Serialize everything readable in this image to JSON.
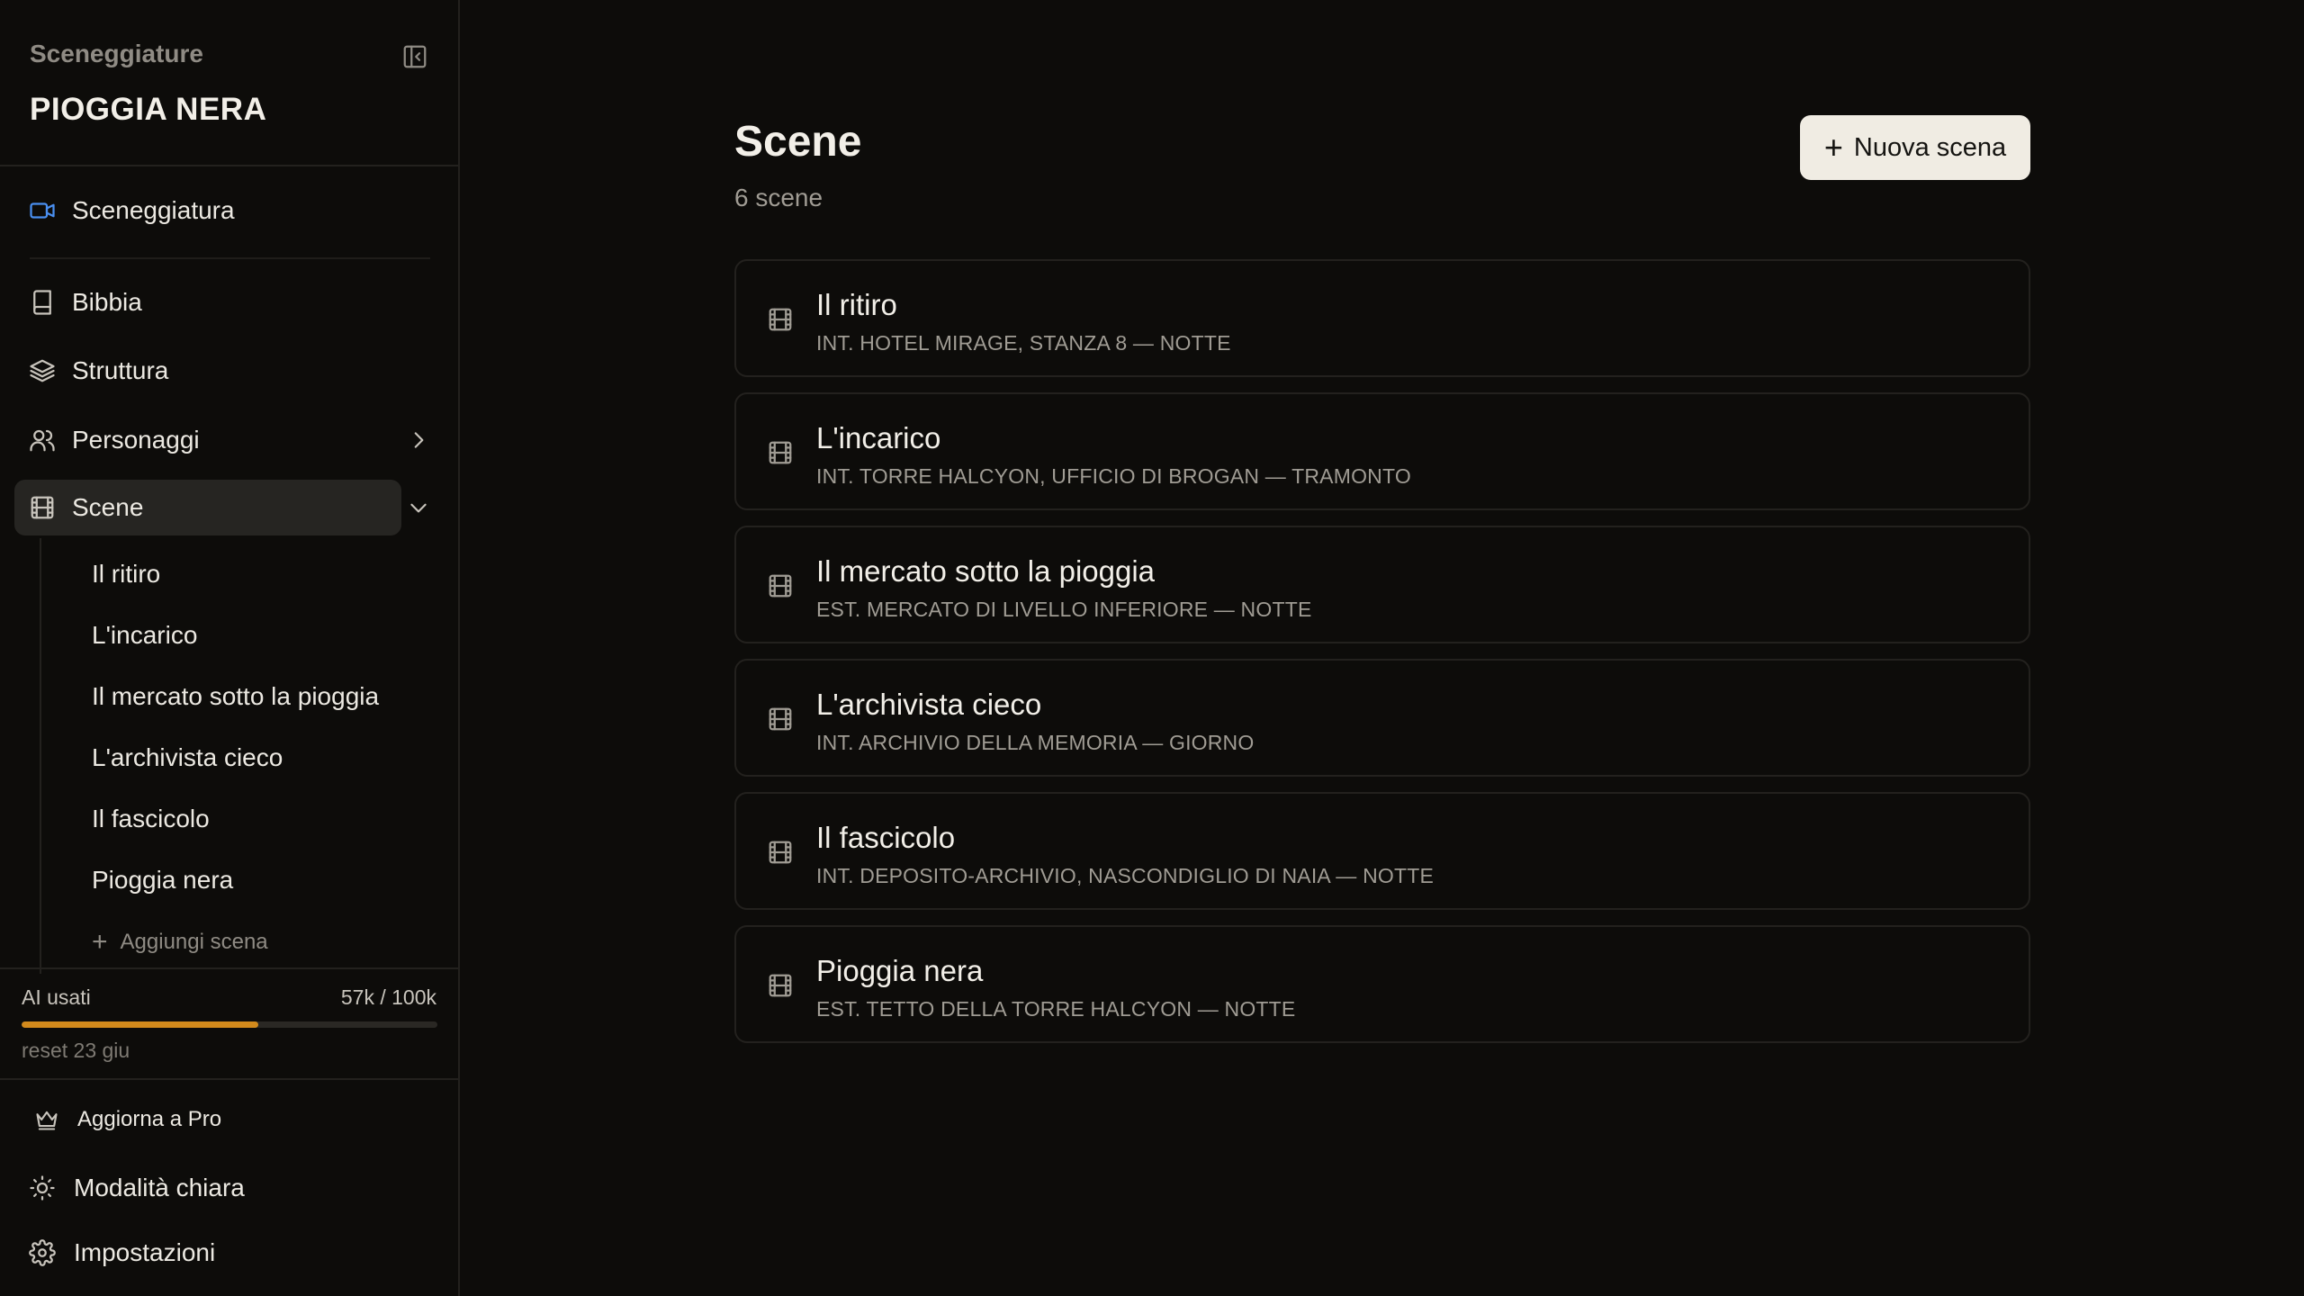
{
  "sidebar": {
    "app_name": "Sceneggiature",
    "project_title": "PIOGGIA NERA",
    "nav": {
      "screenplay": "Sceneggiatura",
      "bible": "Bibbia",
      "structure": "Struttura",
      "characters": "Personaggi",
      "scenes": "Scene"
    },
    "scene_items": [
      "Il ritiro",
      "L'incarico",
      "Il mercato sotto la pioggia",
      "L'archivista cieco",
      "Il fascicolo",
      "Pioggia nera"
    ],
    "add_scene": "Aggiungi scena",
    "usage": {
      "label": "AI usati",
      "count": "57k / 100k",
      "fraction": 0.57,
      "reset": "reset 23 giu",
      "bar_color": "#d28a1c"
    },
    "footer": {
      "upgrade": "Aggiorna a Pro",
      "light_mode": "Modalità chiara",
      "settings": "Impostazioni"
    }
  },
  "main": {
    "title": "Scene",
    "count": "6 scene",
    "new_button": "Nuova scena",
    "scenes": [
      {
        "title": "Il ritiro",
        "location": "INT. HOTEL MIRAGE, STANZA 8 — NOTTE"
      },
      {
        "title": "L'incarico",
        "location": "INT. TORRE HALCYON, UFFICIO DI BROGAN — TRAMONTO"
      },
      {
        "title": "Il mercato sotto la pioggia",
        "location": "EST. MERCATO DI LIVELLO INFERIORE — NOTTE"
      },
      {
        "title": "L'archivista cieco",
        "location": "INT. ARCHIVIO DELLA MEMORIA — GIORNO"
      },
      {
        "title": "Il fascicolo",
        "location": "INT. DEPOSITO-ARCHIVIO, NASCONDIGLIO DI NAIA — NOTTE"
      },
      {
        "title": "Pioggia nera",
        "location": "EST. TETTO DELLA TORRE HALCYON — NOTTE"
      }
    ]
  },
  "colors": {
    "background": "#0d0c0a",
    "accent_screenplay_icon": "#4a8ff0",
    "active_item_bg": "#262522",
    "button_bg": "#f0ece3"
  }
}
